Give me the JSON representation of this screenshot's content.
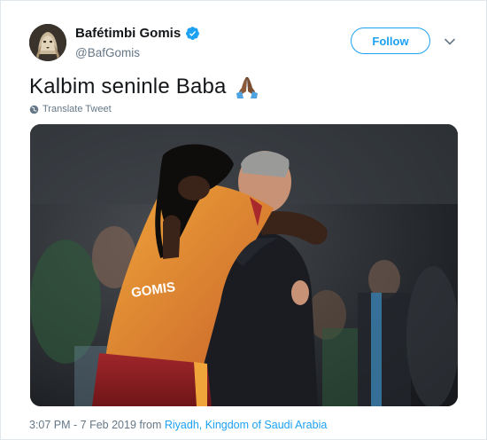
{
  "user": {
    "display_name": "Bafétimbi Gomis",
    "handle": "@BafGomis",
    "verified": true
  },
  "follow_label": "Follow",
  "tweet": {
    "text": "Kalbim seninle Baba",
    "emoji": "folded-hands",
    "translate_label": "Translate Tweet"
  },
  "photo": {
    "jersey_text": "GOMIS"
  },
  "meta": {
    "time": "3:07 PM - 7 Feb 2019 from ",
    "location": "Riyadh, Kingdom of Saudi Arabia"
  },
  "icons": [
    "verified-badge-icon",
    "chevron-down-icon",
    "globe-icon",
    "folded-hands-emoji"
  ],
  "colors": {
    "accent": "#1da1f2",
    "secondary_text": "#657786",
    "primary_text": "#14171a"
  }
}
